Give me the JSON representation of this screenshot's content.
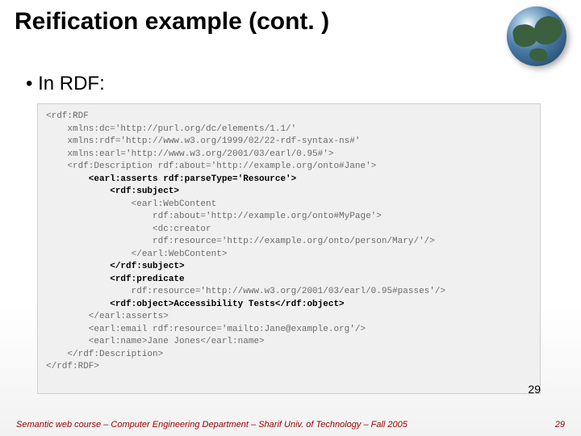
{
  "title": "Reification example (cont. )",
  "bullet": "In RDF:",
  "code_plain_1": "<rdf:RDF\n    xmlns:dc='http://purl.org/dc/elements/1.1/'\n    xmlns:rdf='http://www.w3.org/1999/02/22-rdf-syntax-ns#'\n    xmlns:earl='http://www.w3.org/2001/03/earl/0.95#'>\n    <rdf:Description rdf:about='http://example.org/onto#Jane'>",
  "code_bold_1": "        <earl:asserts rdf:parseType='Resource'>\n            <rdf:subject>",
  "code_plain_2": "                <earl:WebContent\n                    rdf:about='http://example.org/onto#MyPage'>\n                    <dc:creator\n                    rdf:resource='http://example.org/onto/person/Mary/'/>\n                </earl:WebContent>",
  "code_bold_2": "            </rdf:subject>\n            <rdf:predicate",
  "code_plain_3": "                rdf:resource='http://www.w3.org/2001/03/earl/0.95#passes'/>",
  "code_bold_3": "            <rdf:object>Accessibility Tests</rdf:object>",
  "code_plain_4": "        </earl:asserts>\n        <earl:email rdf:resource='mailto:Jane@example.org'/>\n        <earl:name>Jane Jones</earl:name>\n    </rdf:Description>\n</rdf:RDF>",
  "page_number_inner": "29",
  "footer": "Semantic web course – Computer Engineering Department – Sharif Univ. of Technology – Fall 2005",
  "page_number_outer": "29"
}
